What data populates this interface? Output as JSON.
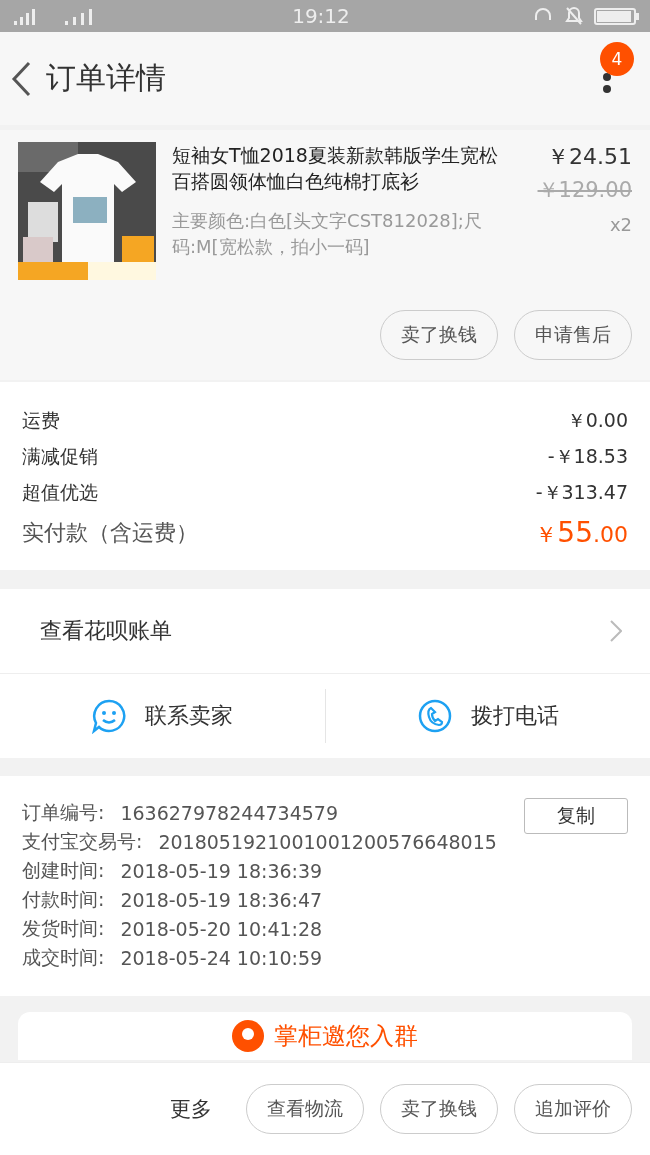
{
  "status_bar": {
    "time": "19:12"
  },
  "header": {
    "title": "订单详情",
    "badge": "4"
  },
  "product": {
    "image": {
      "kind": "picture"
    },
    "title": "短袖女T恤2018夏装新款韩版学生宽松百搭圆领体恤白色纯棉打底衫",
    "specs": "主要颜色:白色[头文字CST812028];尺码:M[宽松款，拍小一码]",
    "price": "￥24.51",
    "original_price": "￥129.00",
    "quantity": "x2",
    "actions": [
      "卖了换钱",
      "申请售后"
    ]
  },
  "costs": [
    {
      "label": "运费",
      "value": "￥0.00"
    },
    {
      "label": "满减促销",
      "value": "-￥18.53"
    },
    {
      "label": "超值优选",
      "value": "-￥313.47"
    }
  ],
  "total": {
    "label": "实付款（含运费）",
    "currency": "￥",
    "integer": "55",
    "decimal": ".00"
  },
  "huabei": {
    "label": "查看花呗账单"
  },
  "contact": [
    {
      "kind": "chat",
      "label": "联系卖家"
    },
    {
      "kind": "phone",
      "label": "拨打电话"
    }
  ],
  "order_info": {
    "copy_button": "复制",
    "rows": [
      {
        "label": "订单编号:",
        "value": "163627978244734579"
      },
      {
        "label": "支付宝交易号:",
        "value": "2018051921001001200576648015"
      },
      {
        "label": "创建时间:",
        "value": "2018-05-19 18:36:39"
      },
      {
        "label": "付款时间:",
        "value": "2018-05-19 18:36:47"
      },
      {
        "label": "发货时间:",
        "value": "2018-05-20 10:41:28"
      },
      {
        "label": "成交时间:",
        "value": "2018-05-24 10:10:59"
      }
    ]
  },
  "group_card": {
    "text": "掌柜邀您入群"
  },
  "footer": {
    "more": "更多",
    "buttons": [
      "查看物流",
      "卖了换钱",
      "追加评价"
    ]
  }
}
